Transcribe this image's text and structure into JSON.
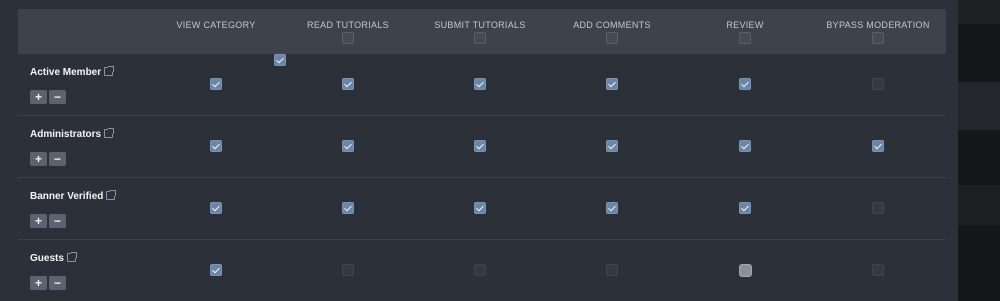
{
  "columns": [
    {
      "label": "VIEW CATEGORY",
      "checked": true
    },
    {
      "label": "READ TUTORIALS",
      "checked": false
    },
    {
      "label": "SUBMIT TUTORIALS",
      "checked": false
    },
    {
      "label": "ADD COMMENTS",
      "checked": false
    },
    {
      "label": "REVIEW",
      "checked": false
    },
    {
      "label": "BYPASS MODERATION",
      "checked": false
    }
  ],
  "buttons": {
    "plus": "+",
    "minus": "−"
  },
  "rows": [
    {
      "name": "Active Member",
      "perms": [
        "checked",
        "checked",
        "checked",
        "checked",
        "checked",
        "disabled"
      ]
    },
    {
      "name": "Administrators",
      "perms": [
        "checked",
        "checked",
        "checked",
        "checked",
        "checked",
        "checked"
      ]
    },
    {
      "name": "Banner Verified",
      "perms": [
        "checked",
        "checked",
        "checked",
        "checked",
        "checked",
        "disabled"
      ]
    },
    {
      "name": "Guests",
      "perms": [
        "checked",
        "disabled",
        "disabled",
        "disabled",
        "highlight",
        "disabled"
      ]
    }
  ]
}
